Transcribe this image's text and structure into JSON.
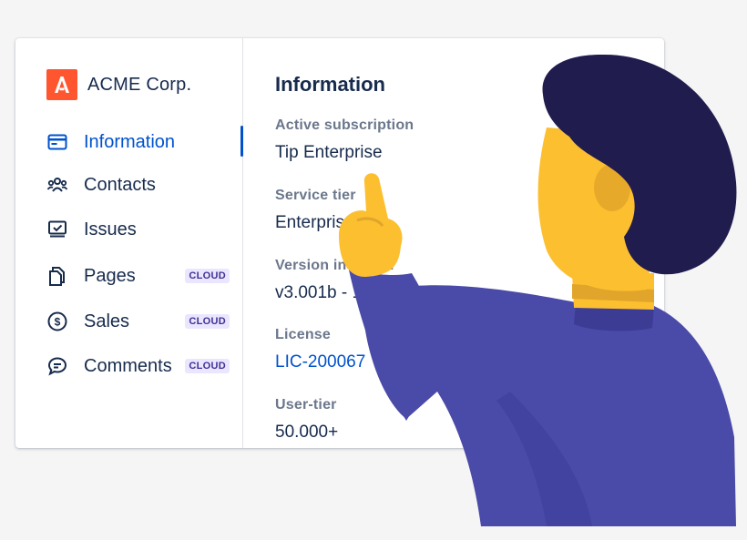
{
  "brand": {
    "name": "ACME Corp.",
    "logo_letter": "A",
    "logo_color": "#ff5630"
  },
  "sidebar": {
    "items": [
      {
        "label": "Information",
        "icon": "window-icon",
        "active": true,
        "badge": ""
      },
      {
        "label": "Contacts",
        "icon": "people-icon",
        "active": false,
        "badge": ""
      },
      {
        "label": "Issues",
        "icon": "monitor-check-icon",
        "active": false,
        "badge": ""
      },
      {
        "label": "Pages",
        "icon": "pages-icon",
        "active": false,
        "badge": "CLOUD"
      },
      {
        "label": "Sales",
        "icon": "dollar-icon",
        "active": false,
        "badge": "CLOUD"
      },
      {
        "label": "Comments",
        "icon": "comment-icon",
        "active": false,
        "badge": "CLOUD"
      }
    ]
  },
  "main": {
    "title": "Information",
    "fields": [
      {
        "label": "Active subscription",
        "value": "Tip Enterprise"
      },
      {
        "label": "Service tier",
        "value": "Enterprise"
      },
      {
        "label": "Version installed",
        "value": "v3.001b - 1f23ac"
      },
      {
        "label": "License",
        "value": "LIC-200067"
      },
      {
        "label": "User-tier",
        "value": "50.000+"
      }
    ]
  },
  "colors": {
    "accent": "#0052cc",
    "text": "#172b4d",
    "muted": "#6b778c",
    "badge_bg": "#eae6ff",
    "badge_text": "#403294",
    "person_shirt": "#4a4aa8",
    "person_skin": "#fcbf30",
    "person_hair": "#201c4e"
  }
}
